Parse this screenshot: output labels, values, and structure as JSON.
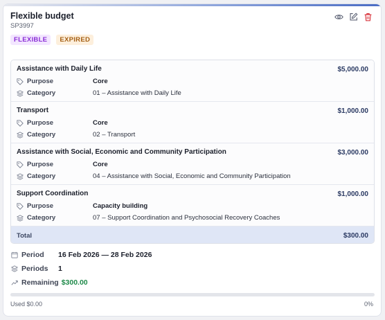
{
  "budget": {
    "title": "Flexible budget",
    "code": "SP3997",
    "badges": {
      "type": "FLEXIBLE",
      "status": "EXPIRED"
    }
  },
  "actions": {
    "icons": [
      "eye-icon",
      "edit-icon",
      "trash-icon"
    ]
  },
  "items": [
    {
      "name": "Assistance with Daily Life",
      "amount": "$5,000.00",
      "purpose_label": "Purpose",
      "purpose": "Core",
      "category_label": "Category",
      "category": "01 – Assistance with Daily Life"
    },
    {
      "name": "Transport",
      "amount": "$1,000.00",
      "purpose_label": "Purpose",
      "purpose": "Core",
      "category_label": "Category",
      "category": "02 – Transport"
    },
    {
      "name": "Assistance with Social, Economic and Community Participation",
      "amount": "$3,000.00",
      "purpose_label": "Purpose",
      "purpose": "Core",
      "category_label": "Category",
      "category": "04 – Assistance with Social, Economic and Community Participation"
    },
    {
      "name": "Support Coordination",
      "amount": "$1,000.00",
      "purpose_label": "Purpose",
      "purpose": "Capacity building",
      "category_label": "Category",
      "category": "07 – Support Coordination and Psychosocial Recovery Coaches"
    }
  ],
  "total": {
    "label": "Total",
    "value": "$300.00"
  },
  "meta": {
    "period_label": "Period",
    "period": "16 Feb 2026 — 28 Feb 2026",
    "periods_label": "Periods",
    "periods": "1",
    "remaining_label": "Remaining",
    "remaining": "$300.00"
  },
  "usage": {
    "used": "Used $0.00",
    "percent_text": "0%",
    "fraction": 0
  },
  "colors": {
    "accent": "#4a6cc4",
    "flexible_badge": "#8a2ed6",
    "expired_badge": "#a56015",
    "remaining": "#1f8a4a",
    "total_bg": "#dfe6f6"
  }
}
